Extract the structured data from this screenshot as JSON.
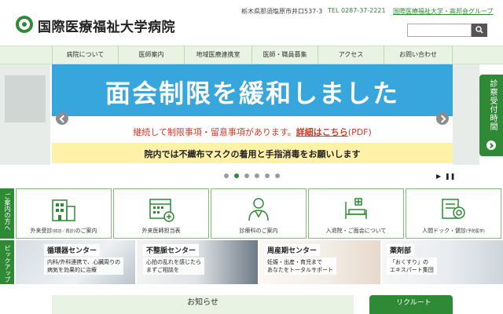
{
  "header": {
    "logo_text": "国際医療福祉大学病院",
    "address": "栃木県那須塩原市井口537-3",
    "tel": "TEL 0287-37-2221",
    "group_link": "国際医療福祉大学・高邦会グループ",
    "search_placeholder": ""
  },
  "nav": {
    "items": [
      "病院について",
      "医師案内",
      "地域医療連携室",
      "医師・職員募集",
      "アクセス",
      "お問い合わせ"
    ]
  },
  "hero": {
    "title": "面会制限を緩和しました",
    "notice_text": "継続して制限事項・留意事項があります。",
    "notice_link": "詳細はこちら",
    "notice_suffix": "(PDF)",
    "mask_text": "院内では不織布マスクの着用と手指消毒をお願いします"
  },
  "side_tab": {
    "label": "診察受付時間"
  },
  "slider": {
    "dot_count": 6,
    "active_index": 1,
    "play": "▶",
    "pause": "❚❚"
  },
  "guide": {
    "section_label": "ご案内の方へ",
    "items": [
      {
        "label": "外来受診",
        "sub": "(初診／再診)",
        "tail": "のご案内",
        "icon": "building-icon"
      },
      {
        "label": "外来医師担当表",
        "sub": "",
        "tail": "",
        "icon": "calendar-icon"
      },
      {
        "label": "診療科のご案内",
        "sub": "",
        "tail": "",
        "icon": "doctor-icon"
      },
      {
        "label": "入退院・ご面会について",
        "sub": "",
        "tail": "",
        "icon": "bed-icon"
      },
      {
        "label": "人間ドック・健診",
        "sub": "(予防医学)",
        "tail": "",
        "icon": "checkup-icon"
      }
    ]
  },
  "pickup": {
    "section_label": "ピックアップ",
    "items": [
      {
        "title": "循環器センター",
        "line1": "内科/外科連携で、心臓周りの",
        "line2": "病気を効果的に治療"
      },
      {
        "title": "不整脈センター",
        "line1": "心拍の乱れを感じたら",
        "line2": "まずご相談を"
      },
      {
        "title": "周産期センター",
        "line1": "妊娠・出産・育児まで",
        "line2": "あなたをトータルサポート"
      },
      {
        "title": "薬剤部",
        "line1": "「おくすり」の",
        "line2": "エキスパート集団"
      }
    ]
  },
  "bottom": {
    "news_title": "お知らせ",
    "recruit_title": "リクルート"
  },
  "colors": {
    "brand_green": "#2f8a35",
    "hero_blue": "#37a6dc",
    "notice_red": "#d23b2a",
    "mask_yellow": "#fff2a8"
  }
}
